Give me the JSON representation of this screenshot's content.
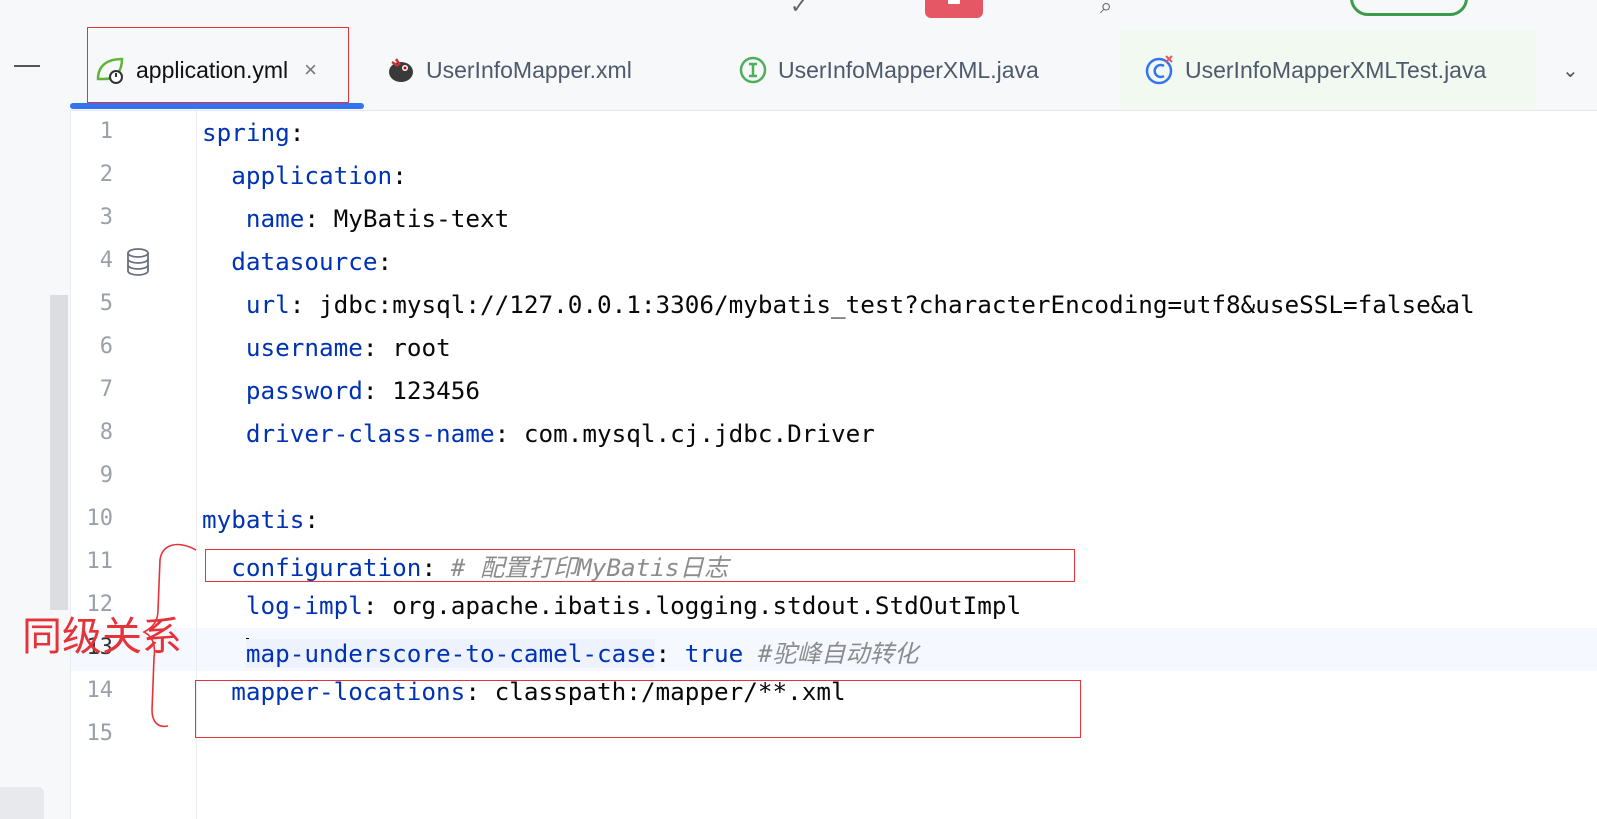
{
  "tabs": [
    {
      "label": "application.yml",
      "icon": "spring-yaml-icon",
      "active": true,
      "closable": true
    },
    {
      "label": "UserInfoMapper.xml",
      "icon": "mybatis-bird-icon",
      "active": false
    },
    {
      "label": "UserInfoMapperXML.java",
      "icon": "interface-icon",
      "active": false
    },
    {
      "label": "UserInfoMapperXMLTest.java",
      "icon": "test-class-icon",
      "active": false
    }
  ],
  "editor": {
    "lines": [
      {
        "n": "1",
        "key": "spring",
        "indent": "",
        "sep": ":",
        "value": "",
        "comment": ""
      },
      {
        "n": "2",
        "key": "application",
        "indent": "  ",
        "sep": ":",
        "value": "",
        "comment": ""
      },
      {
        "n": "3",
        "key": "name",
        "indent": "   ",
        "sep": ":",
        "value": " MyBatis-text",
        "comment": ""
      },
      {
        "n": "4",
        "key": "datasource",
        "indent": "  ",
        "sep": ":",
        "value": "",
        "comment": ""
      },
      {
        "n": "5",
        "key": "url",
        "indent": "   ",
        "sep": ":",
        "value": " jdbc:mysql://127.0.0.1:3306/mybatis_test?characterEncoding=utf8&useSSL=false&al",
        "comment": ""
      },
      {
        "n": "6",
        "key": "username",
        "indent": "   ",
        "sep": ":",
        "value": " root",
        "comment": ""
      },
      {
        "n": "7",
        "key": "password",
        "indent": "   ",
        "sep": ":",
        "value": " 123456",
        "comment": ""
      },
      {
        "n": "8",
        "key": "driver-class-name",
        "indent": "   ",
        "sep": ":",
        "value": " com.mysql.cj.jdbc.Driver",
        "comment": ""
      },
      {
        "n": "9",
        "key": "",
        "indent": "",
        "sep": "",
        "value": "",
        "comment": ""
      },
      {
        "n": "10",
        "key": "mybatis",
        "indent": "",
        "sep": ":",
        "value": "",
        "comment": ""
      },
      {
        "n": "11",
        "key": "configuration",
        "indent": "  ",
        "sep": ":",
        "value": " ",
        "comment": "# 配置打印MyBatis日志"
      },
      {
        "n": "12",
        "key": "log-impl",
        "indent": "   ",
        "sep": ":",
        "value": " org.apache.ibatis.logging.stdout.StdOutImpl",
        "comment": ""
      },
      {
        "n": "13",
        "key": "map-underscore-to-camel-case",
        "indent": "   ",
        "sep": ":",
        "value": " ",
        "bool": "true",
        "comment": " #驼峰自动转化",
        "current": true
      },
      {
        "n": "14",
        "key": "mapper-locations",
        "indent": "  ",
        "sep": ":",
        "value": " classpath:/mapper/**.xml",
        "comment": ""
      },
      {
        "n": "15",
        "key": "",
        "indent": "",
        "sep": "",
        "value": "",
        "comment": ""
      }
    ]
  },
  "annotation": {
    "text": "同级关系",
    "color": "#e5333a"
  },
  "colors": {
    "key": "#0033b3",
    "comment": "#8c8c8c",
    "accent": "#3574f0",
    "annotation": "#e5333a"
  }
}
